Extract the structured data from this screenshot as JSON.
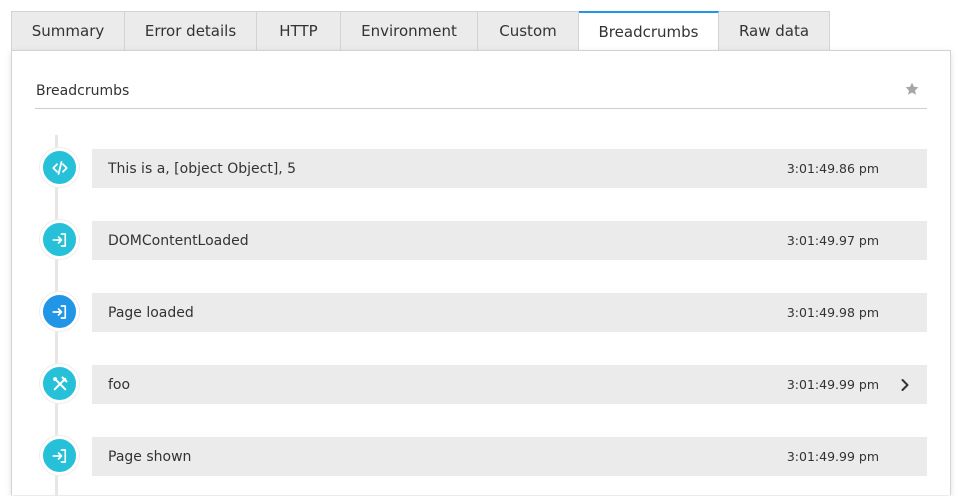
{
  "tabs": [
    {
      "label": "Summary",
      "active": false
    },
    {
      "label": "Error details",
      "active": false
    },
    {
      "label": "HTTP",
      "active": false
    },
    {
      "label": "Environment",
      "active": false
    },
    {
      "label": "Custom",
      "active": false
    },
    {
      "label": "Breadcrumbs",
      "active": true
    },
    {
      "label": "Raw data",
      "active": false
    }
  ],
  "panel": {
    "title": "Breadcrumbs",
    "favorite_icon": "star-icon"
  },
  "colors": {
    "tab_active_accent": "#2196e6",
    "icon_teal": "#26c1d8",
    "icon_blue": "#2196e6",
    "row_background": "#ebebeb"
  },
  "breadcrumbs": [
    {
      "label": "This is a, [object Object], 5",
      "time": "3:01:49.86 pm",
      "icon": "code-icon",
      "expandable": false
    },
    {
      "label": "DOMContentLoaded",
      "time": "3:01:49.97 pm",
      "icon": "sign-in-icon",
      "expandable": false
    },
    {
      "label": "Page loaded",
      "time": "3:01:49.98 pm",
      "icon": "sign-in-icon",
      "expandable": false
    },
    {
      "label": "foo",
      "time": "3:01:49.99 pm",
      "icon": "tools-icon",
      "expandable": true
    },
    {
      "label": "Page shown",
      "time": "3:01:49.99 pm",
      "icon": "sign-in-icon",
      "expandable": false
    }
  ]
}
